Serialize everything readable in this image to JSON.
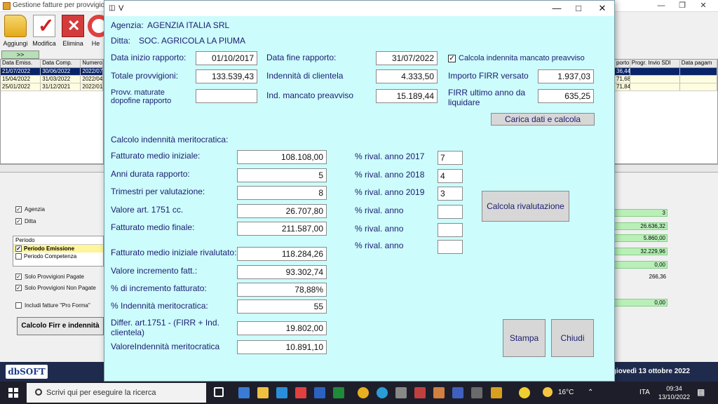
{
  "background_app": {
    "title": "Gestione fatture per provvigioni",
    "toolbar": [
      {
        "label": "Aggiungi",
        "icon": "folder-add-icon"
      },
      {
        "label": "Modifica",
        "icon": "checkmark-icon"
      },
      {
        "label": "Elimina",
        "icon": "delete-x-icon"
      },
      {
        "label": "He",
        "icon": "lifebuoy-help-icon"
      }
    ],
    "nav_arrows": ">>",
    "left_grid": {
      "headers": [
        "Data Emiss.",
        "Data Comp.",
        "Numero"
      ],
      "rows": [
        [
          "21/07/2022",
          "30/06/2022",
          "2022/07"
        ],
        [
          "15/04/2022",
          "31/03/2022",
          "2022/04"
        ],
        [
          "25/01/2022",
          "31/12/2021",
          "2022/01"
        ]
      ]
    },
    "right_grid": {
      "headers": [
        "porto",
        "Progr. Invio SDI",
        "Data pagam"
      ],
      "rows": [
        [
          "36,44",
          "",
          ""
        ],
        [
          "71,68",
          "",
          ""
        ],
        [
          "71,84",
          "",
          ""
        ]
      ]
    },
    "filters": {
      "agenzia": "Agenzia",
      "ditta": "Ditta",
      "periodo_title": "Periodo",
      "periodo_emissione": "Periodo Emissione",
      "periodo_competenza": "Periodo Competenza",
      "solo_pagate": "Solo Provvigioni Pagate",
      "solo_non_pagate": "Solo Provvigioni Non Pagate",
      "pro_forma": "Includi fatture \"Pro Forma\"",
      "calc_button": "Calcolo Firr e indennità"
    },
    "right_values": [
      "3",
      "26.636,32",
      "5.860,00",
      "32.229,96",
      "0,00",
      "266,36",
      "0,00"
    ],
    "brand": "dbSOFT",
    "status_date": "giovedì 13 ottobre 2022"
  },
  "dialog": {
    "title": "V",
    "agenzia_label": "Agenzia:",
    "agenzia_value": "AGENZIA ITALIA SRL",
    "ditta_label": "Ditta:",
    "ditta_value": "SOC. AGRICOLA LA PIUMA",
    "data_inizio_label": "Data inizio rapporto:",
    "data_inizio_value": "01/10/2017",
    "data_fine_label": "Data fine rapporto:",
    "data_fine_value": "31/07/2022",
    "mancato_preavviso_label": "Calcola indennita mancato preavviso",
    "totale_provvigioni_label": "Totale provvigioni:",
    "totale_provvigioni_value": "133.539,43",
    "indennita_clientela_label": "Indennità di clientela",
    "indennita_clientela_value": "4.333,50",
    "importo_firr_label": "Importo FIRR versato",
    "importo_firr_value": "1.937,03",
    "provv_maturate_label": "Provv. maturate dopofine rapporto",
    "provv_maturate_value": "",
    "ind_mancato_label": "Ind. mancato preavviso",
    "ind_mancato_value": "15.189,44",
    "firr_ultimo_label": "FIRR ultimo anno da liquidare",
    "firr_ultimo_value": "635,25",
    "carica_button": "Carica dati e calcola",
    "calcolo_title": "Calcolo indennità meritocratica:",
    "rows_left": [
      {
        "label": "Fatturato medio iniziale:",
        "value": "108.108,00"
      },
      {
        "label": "Anni durata rapporto:",
        "value": "5"
      },
      {
        "label": "Trimestri per valutazione:",
        "value": "8"
      },
      {
        "label": "Valore art. 1751 cc.",
        "value": "26.707,80"
      },
      {
        "label": "Fatturato medio finale:",
        "value": "211.587,00"
      },
      {
        "label": "Fatturato medio iniziale rivalutato:",
        "value": "118.284,26"
      },
      {
        "label": "Valore incremento fatt.:",
        "value": "93.302,74"
      },
      {
        "label": "% di incremento fatturato:",
        "value": "78,88%"
      },
      {
        "label": "% Indennità meritocratica:",
        "value": "55"
      },
      {
        "label": "Differ. art.1751 - (FIRR + Ind. clientela)",
        "value": "19.802,00"
      },
      {
        "label": "ValoreIndennità meritocratica",
        "value": "10.891,10"
      }
    ],
    "rival": [
      {
        "label": "% rival. anno 2017",
        "value": "7"
      },
      {
        "label": "% rival. anno 2018",
        "value": "4"
      },
      {
        "label": "% rival. anno 2019",
        "value": "3"
      },
      {
        "label": "% rival. anno",
        "value": ""
      },
      {
        "label": "% rival. anno",
        "value": ""
      },
      {
        "label": "% rival. anno",
        "value": ""
      }
    ],
    "calcola_rivalutazione_button": "Calcola rivalutazione",
    "stampa_button": "Stampa",
    "chiudi_button": "Chiudi"
  },
  "taskbar": {
    "search_placeholder": "Scrivi qui per eseguire la ricerca",
    "temperature": "16°C",
    "language": "ITA",
    "time": "09:34",
    "date": "13/10/2022"
  },
  "colors": {
    "dialog_bg": "#ccfcfc",
    "label_text": "#1c1c70",
    "selected_row": "#0a246a",
    "highlight_green": "#b8f0b8"
  }
}
